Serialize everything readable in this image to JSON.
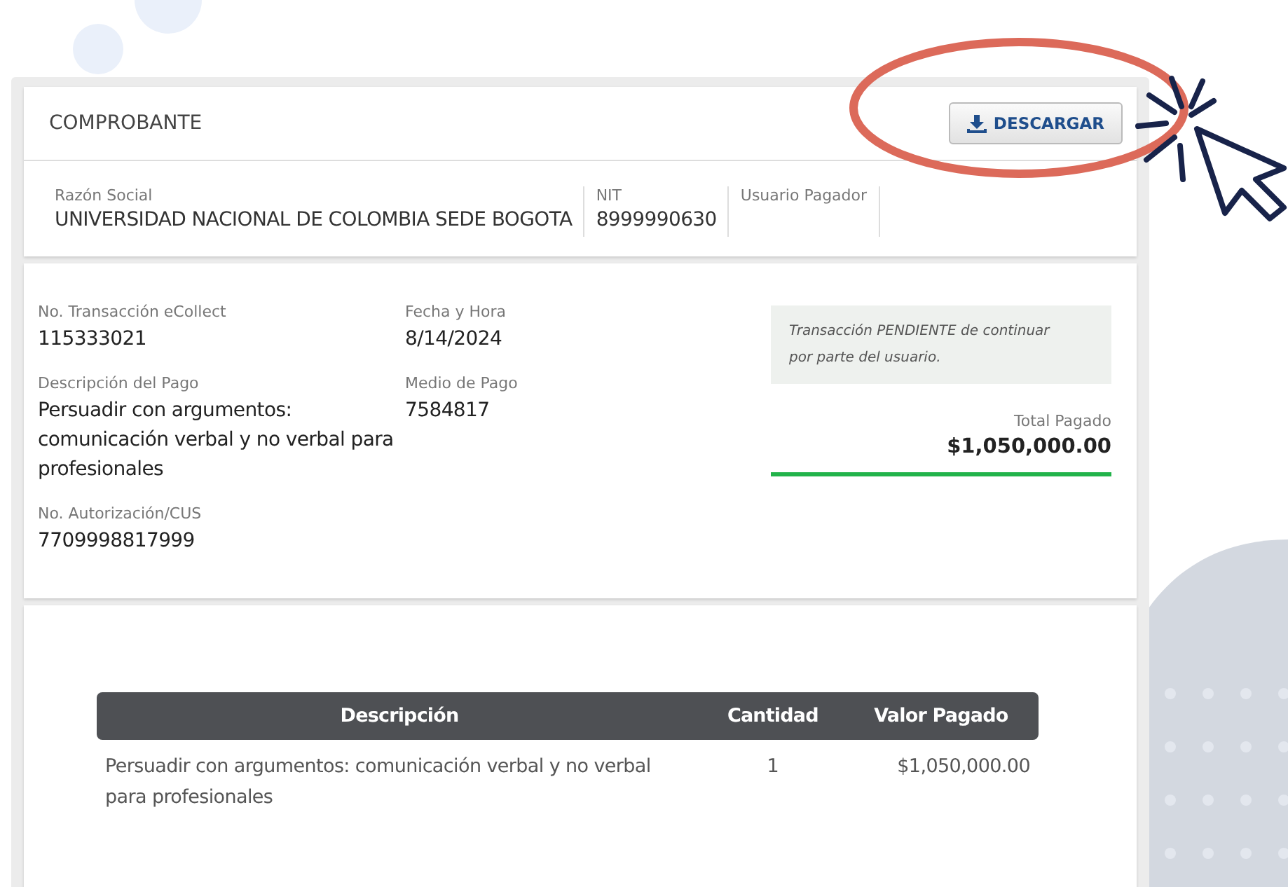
{
  "header": {
    "title": "COMPROBANTE",
    "download_button": "DESCARGAR"
  },
  "entity": [
    {
      "label": "Razón Social",
      "value": "UNIVERSIDAD NACIONAL DE COLOMBIA SEDE BOGOTA"
    },
    {
      "label": "NIT",
      "value": "8999990630"
    },
    {
      "label": "Usuario Pagador"
    }
  ],
  "details": [
    {
      "label": "No. Transacción eCollect",
      "value": "115333021"
    },
    {
      "label": "Fecha y Hora",
      "value": "8/14/2024"
    },
    {
      "label": "Descripción del Pago",
      "value": "Persuadir con argumentos: comunicación verbal y no verbal para profesionales"
    },
    {
      "label": "Medio de Pago",
      "value": "7584817"
    },
    {
      "label": "No. Autorización/CUS",
      "value": "7709998817999"
    }
  ],
  "status_note": "Transacción PENDIENTE de continuar por parte del usuario.",
  "total": {
    "label": "Total Pagado",
    "value": "$1,050,000.00"
  },
  "table": {
    "columns": [
      "Descripción",
      "Cantidad",
      "Valor Pagado"
    ],
    "rows": [
      [
        "Persuadir con argumentos: comunicación verbal y no verbal para profesionales",
        "1",
        "$1,050,000.00"
      ]
    ]
  }
}
